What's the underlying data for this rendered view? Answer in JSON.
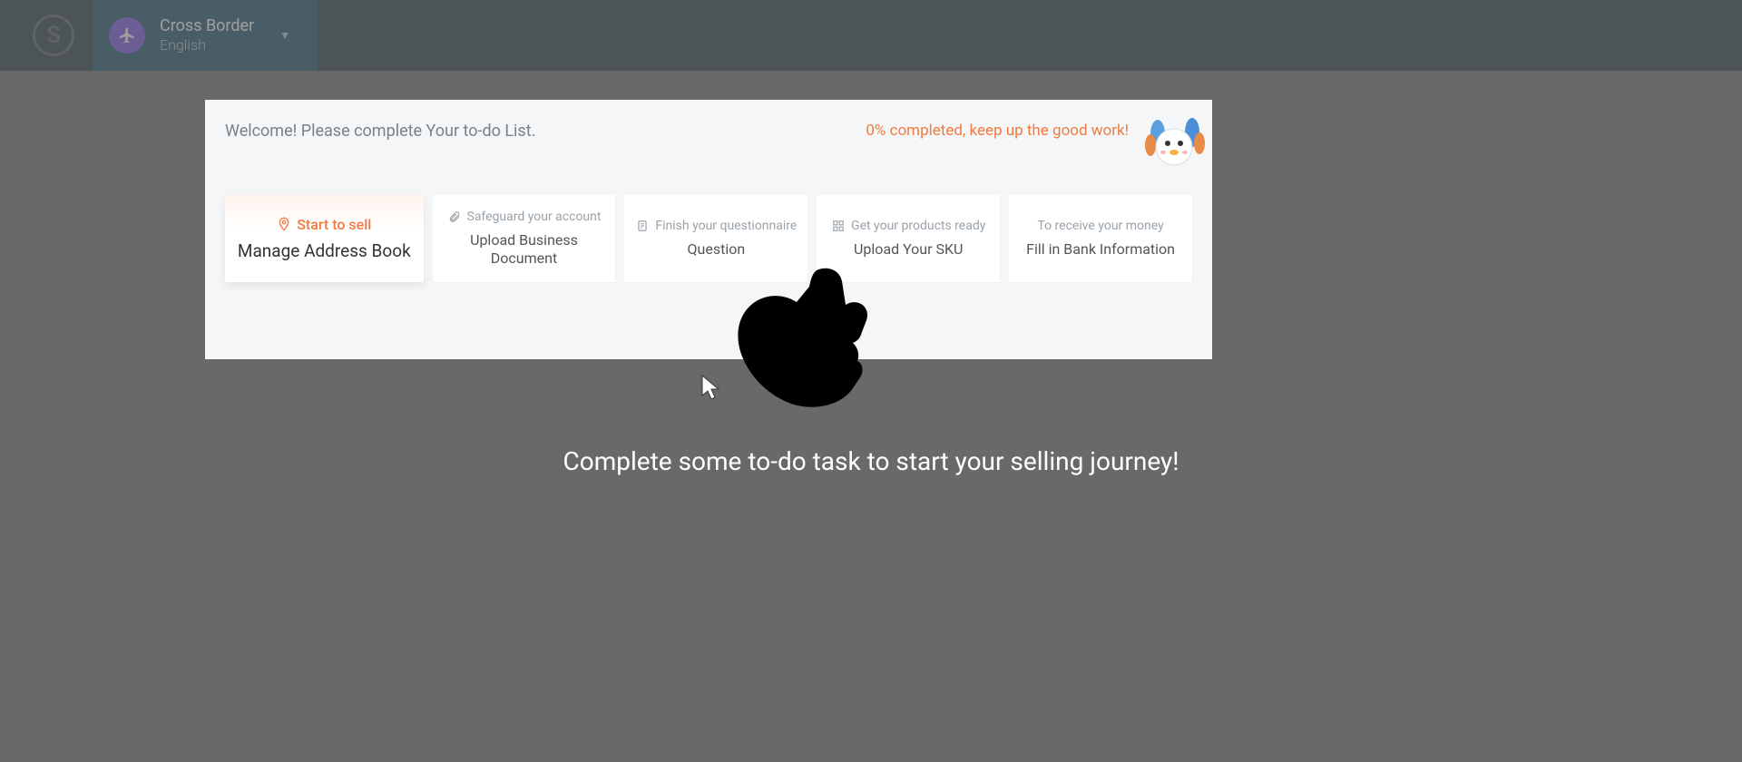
{
  "header": {
    "logo_letter": "S",
    "selector": {
      "line1": "Cross Border",
      "line2": "English"
    }
  },
  "card": {
    "welcome": "Welcome! Please complete Your to-do List.",
    "progress": "0% completed, keep up the good work!"
  },
  "tasks": [
    {
      "category": "Start to sell",
      "action": "Manage Address Book",
      "icon": "location-icon",
      "active": true
    },
    {
      "category": "Safeguard your account",
      "action": "Upload Business Document",
      "icon": "paperclip-icon",
      "active": false
    },
    {
      "category": "Finish your questionnaire",
      "action": "Question",
      "icon": "clipboard-icon",
      "active": false
    },
    {
      "category": "Get your products ready",
      "action": "Upload Your SKU",
      "icon": "grid-icon",
      "active": false
    },
    {
      "category": "To receive your money",
      "action": "Fill in Bank Information",
      "icon": "",
      "active": false
    }
  ],
  "instruction": "Complete some to-do task to start your selling journey!"
}
